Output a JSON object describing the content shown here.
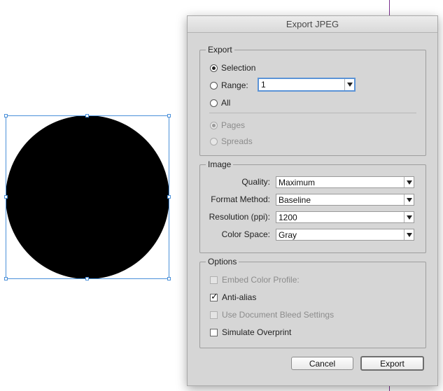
{
  "dialog": {
    "title": "Export JPEG",
    "export_group": {
      "legend": "Export",
      "selection_label": "Selection",
      "range_label": "Range:",
      "range_value": "1",
      "all_label": "All",
      "pages_label": "Pages",
      "spreads_label": "Spreads",
      "selected_option": "Selection"
    },
    "image_group": {
      "legend": "Image",
      "quality_label": "Quality:",
      "quality_value": "Maximum",
      "format_label": "Format Method:",
      "format_value": "Baseline",
      "resolution_label": "Resolution (ppi):",
      "resolution_value": "1200",
      "colorspace_label": "Color Space:",
      "colorspace_value": "Gray"
    },
    "options_group": {
      "legend": "Options",
      "embed_profile_label": "Embed Color Profile:",
      "embed_profile_checked": false,
      "antialias_label": "Anti-alias",
      "antialias_checked": true,
      "bleed_label": "Use Document Bleed Settings",
      "bleed_checked": false,
      "overprint_label": "Simulate Overprint",
      "overprint_checked": false
    },
    "buttons": {
      "cancel": "Cancel",
      "export": "Export"
    }
  },
  "canvas": {
    "shape_fill": "#000000",
    "selection_color": "#4a90d9",
    "guide_color": "#7b2f8e"
  }
}
